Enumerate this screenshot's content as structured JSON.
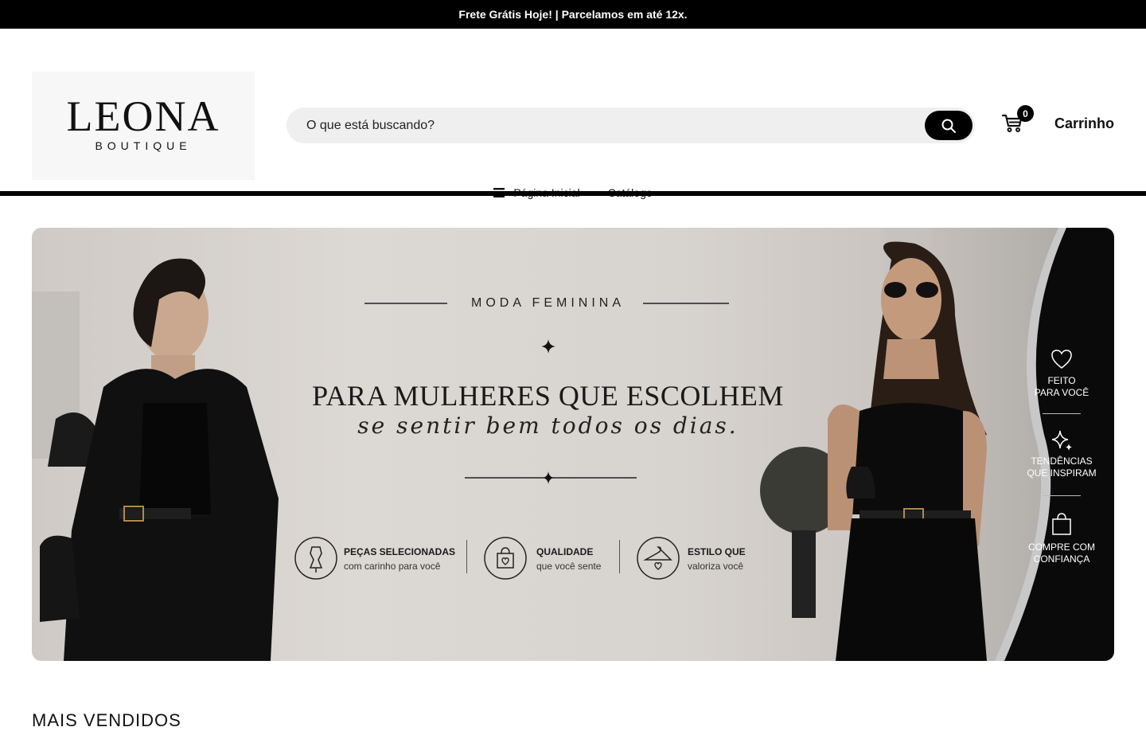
{
  "announcement": "Frete Grátis Hoje! | Parcelamos em até 12x.",
  "logo": {
    "main": "LEONA",
    "sub": "BOUTIQUE"
  },
  "search": {
    "placeholder": "O que está buscando?"
  },
  "cart": {
    "count": "0",
    "label": "Carrinho"
  },
  "nav": [
    {
      "label": "Página Inicial"
    },
    {
      "label": "Catálogo"
    }
  ],
  "banner": {
    "kicker": "MODA FEMININA",
    "headline": "PARA MULHERES QUE ESCOLHEM",
    "script": "se sentir bem todos os dias.",
    "features": [
      {
        "title": "PEÇAS SELECIONADAS",
        "subtitle": "com carinho para você"
      },
      {
        "title": "QUALIDADE",
        "subtitle": "que você sente"
      },
      {
        "title": "ESTILO QUE",
        "subtitle": "valoriza você"
      }
    ],
    "side": [
      {
        "line1": "FEITO",
        "line2": "PARA VOCÊ"
      },
      {
        "line1": "TENDÊNCIAS",
        "line2": "QUE INSPIRAM"
      },
      {
        "line1": "COMPRE COM",
        "line2": "CONFIANÇA"
      }
    ]
  },
  "section": {
    "title": "MAIS VENDIDOS"
  },
  "colors": {
    "bar": "#000000",
    "search_bg": "#efefef"
  }
}
